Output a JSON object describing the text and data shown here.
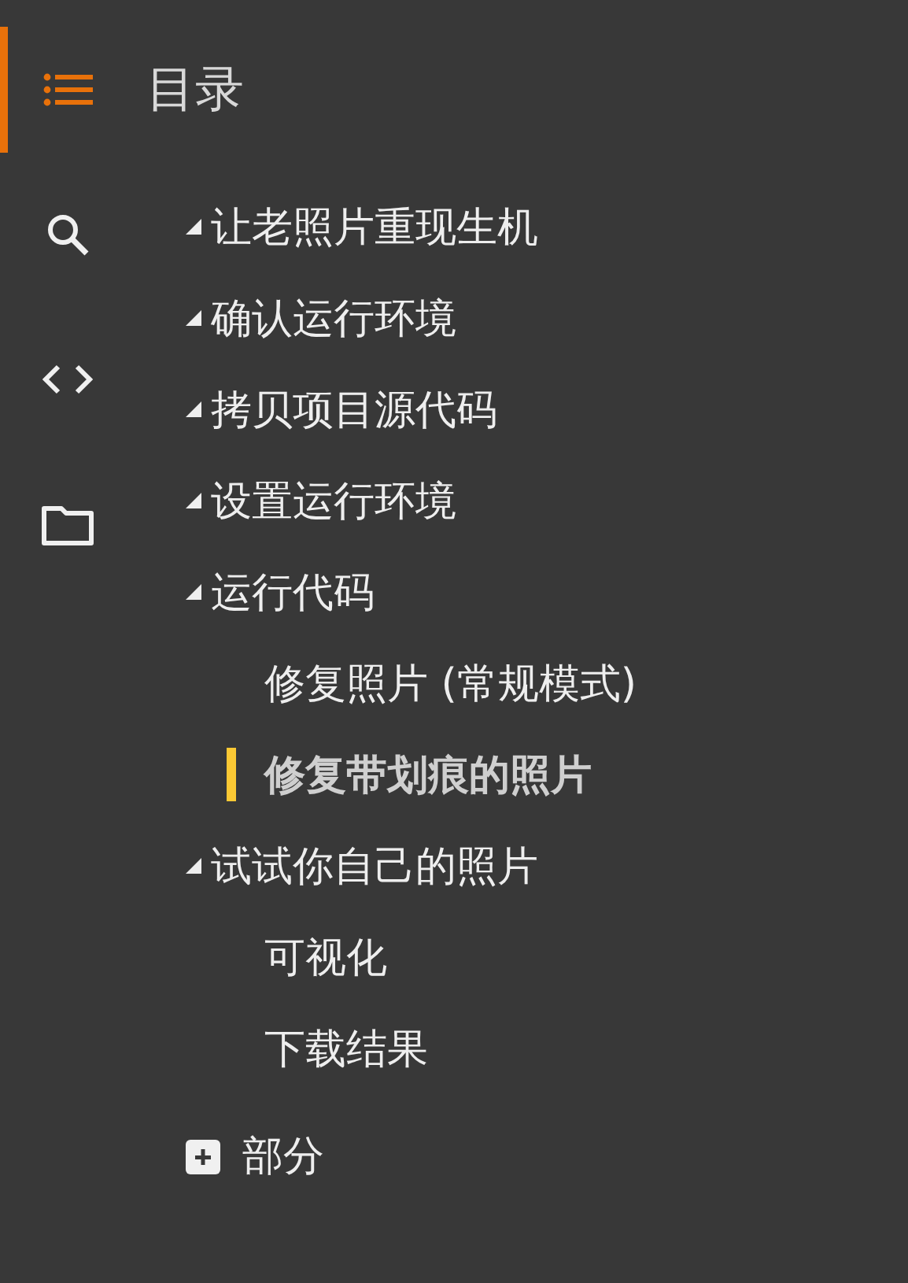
{
  "rail": {
    "items": [
      {
        "kind": "toc",
        "selected": true
      },
      {
        "kind": "search",
        "selected": false
      },
      {
        "kind": "code",
        "selected": false
      },
      {
        "kind": "files",
        "selected": false
      }
    ]
  },
  "panel": {
    "title": "目录",
    "tree": [
      {
        "label": "让老照片重现生机",
        "expanded": true,
        "selected": false
      },
      {
        "label": "确认运行环境",
        "expanded": true,
        "selected": false
      },
      {
        "label": "拷贝项目源代码",
        "expanded": true,
        "selected": false
      },
      {
        "label": "设置运行环境",
        "expanded": true,
        "selected": false
      },
      {
        "label": "运行代码",
        "expanded": true,
        "selected": false,
        "children": [
          {
            "label": "修复照片 (常规模式)",
            "selected": false
          },
          {
            "label": "修复带划痕的照片",
            "selected": true
          }
        ]
      },
      {
        "label": "试试你自己的照片",
        "expanded": true,
        "selected": false,
        "children": [
          {
            "label": "可视化",
            "selected": false
          },
          {
            "label": "下载结果",
            "selected": false
          }
        ]
      }
    ],
    "add_section": {
      "label": "部分"
    }
  }
}
